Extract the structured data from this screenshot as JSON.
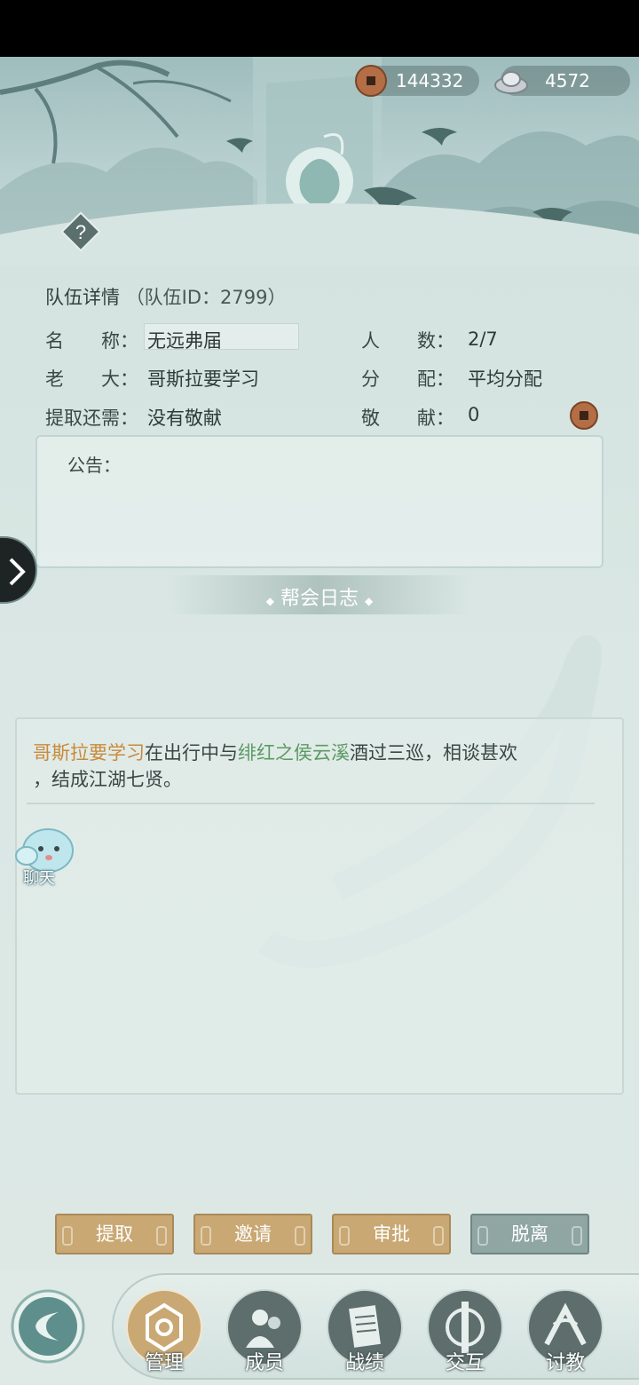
{
  "currency": {
    "copper": "144332",
    "silver": "4572"
  },
  "team": {
    "title": "队伍详情",
    "team_id": "（队伍ID：2799）",
    "name_label": "名　　称：",
    "name_value": "无远弗届",
    "members_label": "人　　数：",
    "members_value": "2/7",
    "leader_label": "老　　大：",
    "leader_value": "哥斯拉要学习",
    "distribution_label": "分　　配：",
    "distribution_value": "平均分配",
    "withdraw_label": "提取还需：",
    "withdraw_value": "没有敬献",
    "tribute_label": "敬　　献：",
    "tribute_value": "0"
  },
  "notice": {
    "label": "公告："
  },
  "log": {
    "title": "帮会日志",
    "entry_actor": "哥斯拉要学习",
    "entry_mid": "在出行中与",
    "entry_target": "绯红之侯云溪",
    "entry_end": "酒过三巡，相谈甚欢",
    "entry_line2": "，结成江湖七贤。"
  },
  "chat": {
    "label": "聊天"
  },
  "actions": {
    "withdraw": "提取",
    "invite": "邀请",
    "approve": "审批",
    "leave": "脱离"
  },
  "nav": {
    "manage": "管理",
    "members": "成员",
    "record": "战绩",
    "interact": "交互",
    "teach": "讨教"
  },
  "colors": {
    "accent_gold": "#c9a874",
    "actor_orange": "#c98a3a",
    "target_green": "#5c9a64"
  }
}
